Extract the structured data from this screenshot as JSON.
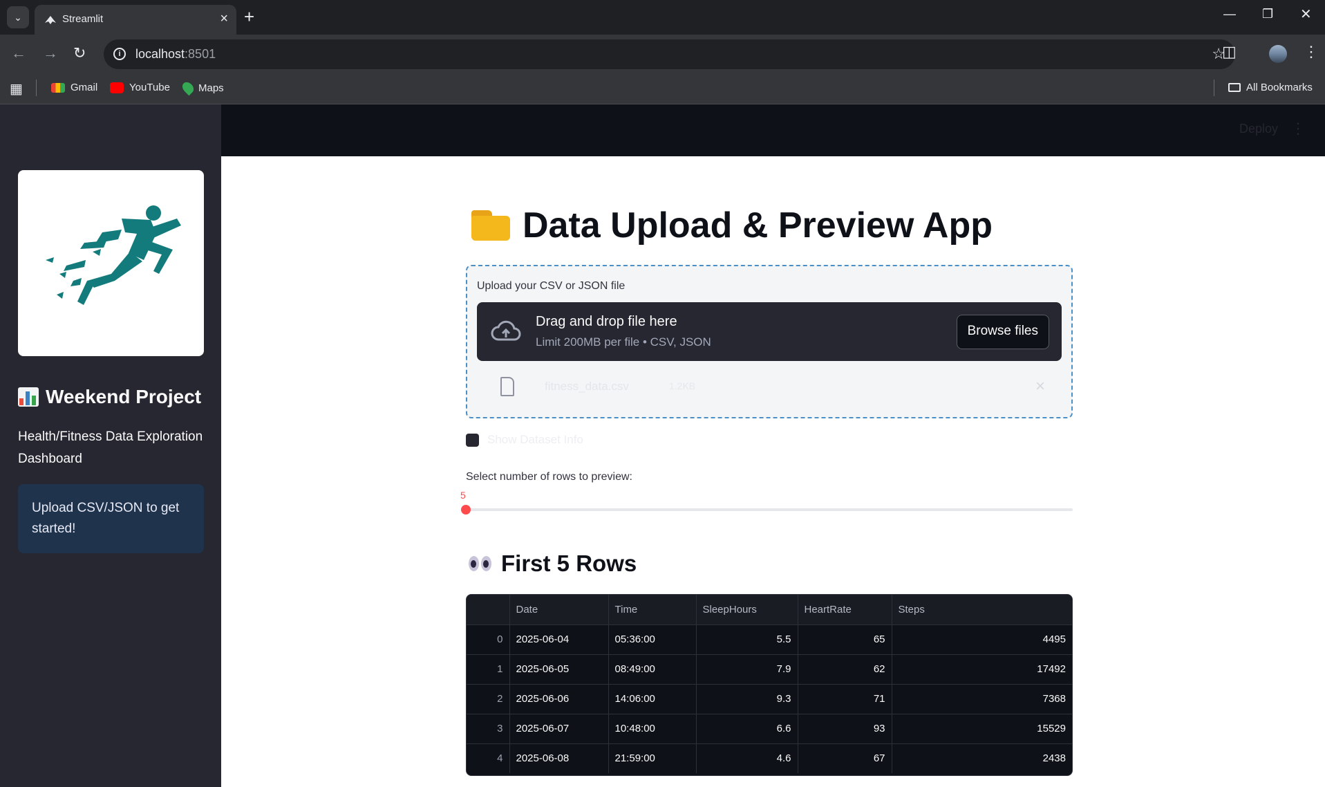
{
  "browser": {
    "tab_title": "Streamlit",
    "url_host": "localhost",
    "url_port": ":8501",
    "bookmarks": [
      {
        "label": "Gmail",
        "icon": "gmail-icon"
      },
      {
        "label": "YouTube",
        "icon": "youtube-icon"
      },
      {
        "label": "Maps",
        "icon": "maps-icon"
      }
    ],
    "all_bookmarks_label": "All Bookmarks"
  },
  "header": {
    "deploy_label": "Deploy"
  },
  "sidebar": {
    "logo_icon": "runner-logo",
    "title": "Weekend Project",
    "title_icon": "bar-chart-icon",
    "description": "Health/Fitness Data Exploration Dashboard",
    "info_message": "Upload CSV/JSON to get started!"
  },
  "main": {
    "title": "Data Upload & Preview App",
    "title_icon": "folder-icon",
    "uploader": {
      "label": "Upload your CSV or JSON file",
      "drop_text": "Drag and drop file here",
      "limit_text": "Limit 200MB per file • CSV, JSON",
      "browse_label": "Browse files",
      "file_name": "fitness_data.csv",
      "file_size": "1.2KB"
    },
    "checkbox_label": "Show Dataset Info",
    "slider": {
      "label": "Select number of rows to preview:",
      "value": "5"
    },
    "preview_title": "First 5 Rows",
    "preview_icon": "eyes-icon",
    "table": {
      "columns": [
        "",
        "Date",
        "Time",
        "SleepHours",
        "HeartRate",
        "Steps"
      ],
      "rows": [
        [
          "0",
          "2025-06-04",
          "05:36:00",
          "5.5",
          "65",
          "4495"
        ],
        [
          "1",
          "2025-06-05",
          "08:49:00",
          "7.9",
          "62",
          "17492"
        ],
        [
          "2",
          "2025-06-06",
          "14:06:00",
          "9.3",
          "71",
          "7368"
        ],
        [
          "3",
          "2025-06-07",
          "10:48:00",
          "6.6",
          "93",
          "15529"
        ],
        [
          "4",
          "2025-06-08",
          "21:59:00",
          "4.6",
          "67",
          "2438"
        ]
      ]
    }
  },
  "colors": {
    "sidebar_bg": "#262730",
    "header_bg": "#0e1117",
    "accent": "#ff4b4b",
    "info_bg": "#1f334d"
  }
}
